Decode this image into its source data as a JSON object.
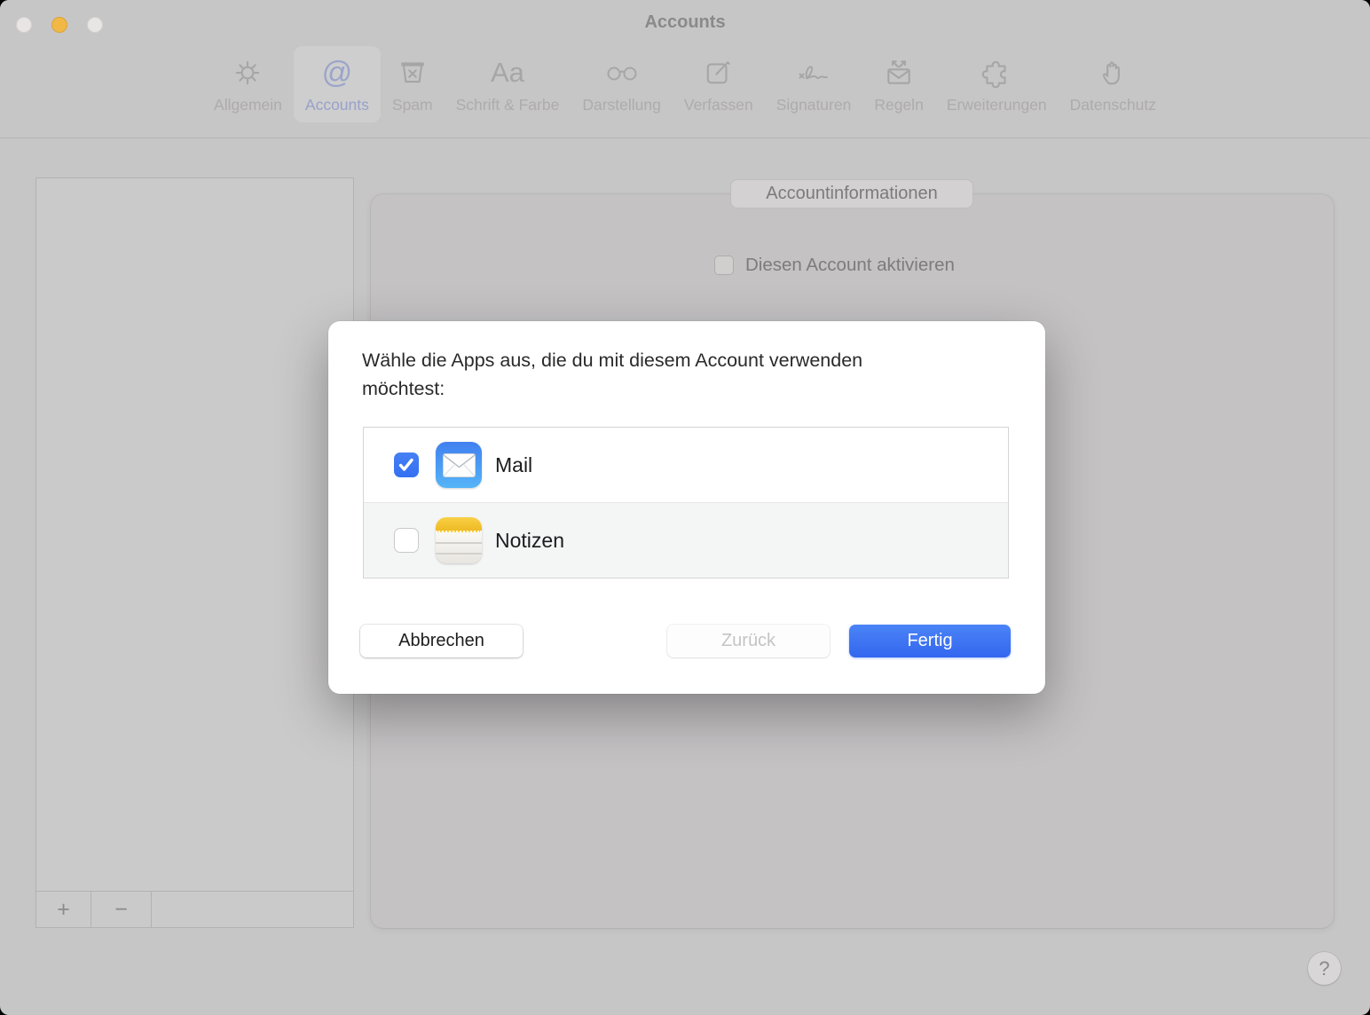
{
  "window": {
    "title": "Accounts",
    "help_label": "?"
  },
  "toolbar": {
    "items": [
      {
        "label": "Allgemein",
        "icon": "gear-icon",
        "selected": false
      },
      {
        "label": "Accounts",
        "icon": "at-icon",
        "selected": true
      },
      {
        "label": "Spam",
        "icon": "trash-icon",
        "selected": false
      },
      {
        "label": "Schrift & Farbe",
        "icon": "fonts-icon",
        "selected": false
      },
      {
        "label": "Darstellung",
        "icon": "glasses-icon",
        "selected": false
      },
      {
        "label": "Verfassen",
        "icon": "compose-icon",
        "selected": false
      },
      {
        "label": "Signaturen",
        "icon": "signature-icon",
        "selected": false
      },
      {
        "label": "Regeln",
        "icon": "rules-icon",
        "selected": false
      },
      {
        "label": "Erweiterungen",
        "icon": "puzzle-icon",
        "selected": false
      },
      {
        "label": "Datenschutz",
        "icon": "hand-icon",
        "selected": false
      }
    ],
    "fonts_glyph": "Aa",
    "at_glyph": "@"
  },
  "sidebar": {
    "add_label": "+",
    "remove_label": "−"
  },
  "content": {
    "tab_label": "Accountinformationen",
    "enable_checkbox_label": "Diesen Account aktivieren",
    "enable_checked": false
  },
  "dialog": {
    "title": "Wähle die Apps aus, die du mit diesem Account verwenden möchtest:",
    "apps": [
      {
        "label": "Mail",
        "icon": "mail-app-icon",
        "checked": true
      },
      {
        "label": "Notizen",
        "icon": "notes-app-icon",
        "checked": false
      }
    ],
    "buttons": {
      "cancel": "Abbrechen",
      "back": "Zurück",
      "back_enabled": false,
      "done": "Fertig"
    },
    "accent_color": "#3b74f3"
  }
}
